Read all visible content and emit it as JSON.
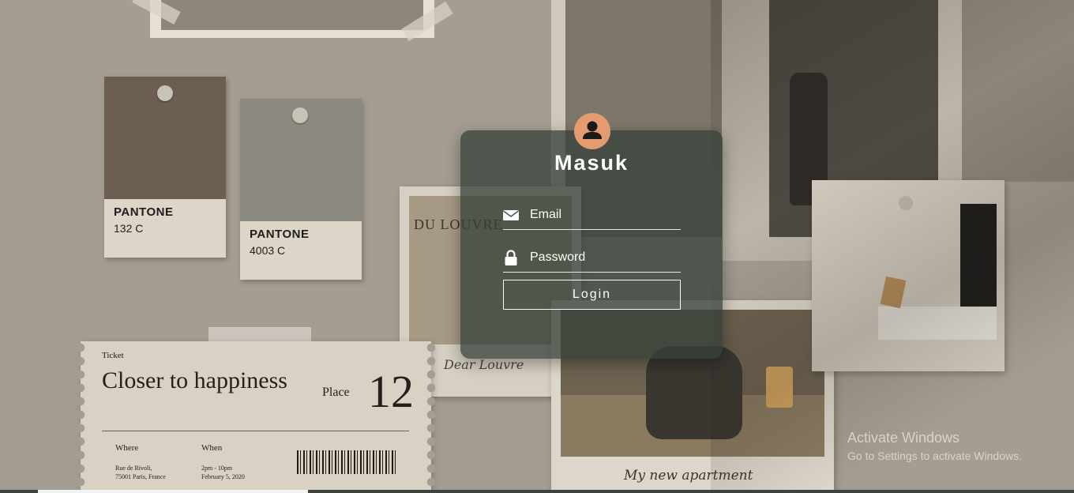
{
  "login": {
    "title": "Masuk",
    "email_placeholder": "Email",
    "password_placeholder": "Password",
    "login_button": "Login",
    "icons": {
      "avatar": "user-icon",
      "email": "envelope-icon",
      "password": "lock-icon"
    },
    "colors": {
      "avatar": "#e59b70",
      "card": "#344038"
    }
  },
  "background": {
    "swatch1": {
      "brand": "PANTONE",
      "code": "132 C",
      "color": "#6c5f51"
    },
    "swatch2": {
      "brand": "PANTONE",
      "code": "4003 C",
      "color": "#8c8a80"
    },
    "louvre": {
      "title": "DU LOUVRE",
      "signature": "Dear Louvre"
    },
    "room": {
      "signature": "My new apartment"
    },
    "ticket": {
      "label": "Ticket",
      "headline": "Closer to happiness",
      "place_label": "Place",
      "place_number": "12",
      "where_label": "Where",
      "when_label": "When",
      "address_line1": "Rue de Rivoli,",
      "address_line2": "75001 Paris, France",
      "time": "2pm - 10pm",
      "date": "February 5, 2020"
    }
  },
  "watermark": {
    "title": "Activate Windows",
    "subtitle": "Go to Settings to activate Windows."
  }
}
